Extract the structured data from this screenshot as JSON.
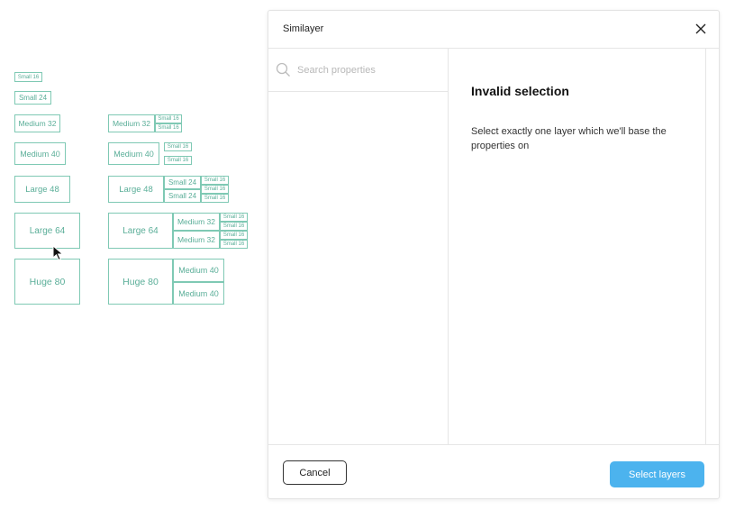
{
  "canvas": {
    "layers": {
      "small_16": "Small 16",
      "small_24": "Small 24",
      "medium_32": "Medium 32",
      "medium_40": "Medium 40",
      "large_48": "Large 48",
      "large_64": "Large 64",
      "huge_80": "Huge 80"
    }
  },
  "plugin": {
    "title": "Similayer",
    "search": {
      "placeholder": "Search properties",
      "value": ""
    },
    "empty_state": {
      "title": "Invalid selection",
      "message": "Select exactly one layer which we'll base the properties on"
    },
    "footer": {
      "cancel_label": "Cancel",
      "select_label": "Select layers"
    }
  },
  "colors": {
    "layer_border": "#7fc9b4",
    "layer_text": "#5aae98",
    "primary_button": "#4cb3ee"
  }
}
